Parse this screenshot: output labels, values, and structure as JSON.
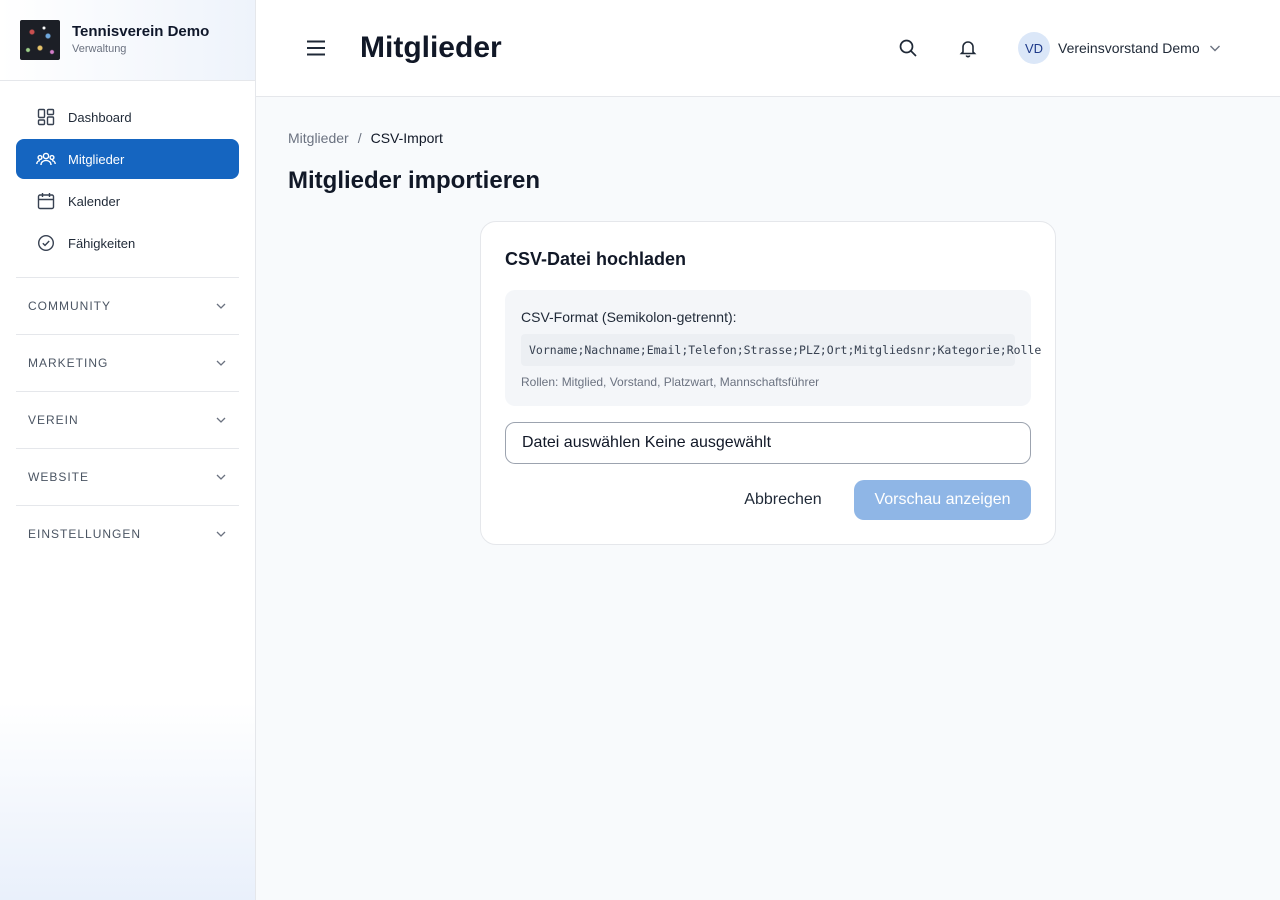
{
  "brand": {
    "title": "Tennisverein Demo",
    "subtitle": "Verwaltung"
  },
  "sidebar": {
    "items": [
      {
        "label": "Dashboard",
        "icon": "dashboard-icon",
        "active": false
      },
      {
        "label": "Mitglieder",
        "icon": "users-icon",
        "active": true
      },
      {
        "label": "Kalender",
        "icon": "calendar-icon",
        "active": false
      },
      {
        "label": "Fähigkeiten",
        "icon": "check-badge-icon",
        "active": false
      }
    ],
    "sections": [
      {
        "label": "COMMUNITY"
      },
      {
        "label": "MARKETING"
      },
      {
        "label": "VEREIN"
      },
      {
        "label": "WEBSITE"
      },
      {
        "label": "EINSTELLUNGEN"
      }
    ]
  },
  "header": {
    "title": "Mitglieder",
    "user": {
      "initials": "VD",
      "name": "Vereinsvorstand Demo"
    }
  },
  "breadcrumb": {
    "parent": "Mitglieder",
    "separator": "/",
    "current": "CSV-Import"
  },
  "main": {
    "title": "Mitglieder importieren",
    "card": {
      "title": "CSV-Datei hochladen",
      "format_label": "CSV-Format (Semikolon-getrennt):",
      "format_code": "Vorname;Nachname;Email;Telefon;Strasse;PLZ;Ort;Mitgliedsnr;Kategorie;Rolle",
      "roles_note": "Rollen: Mitglied, Vorstand, Platzwart, Mannschaftsführer",
      "file_input": "Datei auswählen Keine ausgewählt",
      "cancel_label": "Abbrechen",
      "preview_label": "Vorschau anzeigen"
    }
  },
  "colors": {
    "primary": "#1565c0",
    "primary_disabled": "#8fb6e6"
  }
}
